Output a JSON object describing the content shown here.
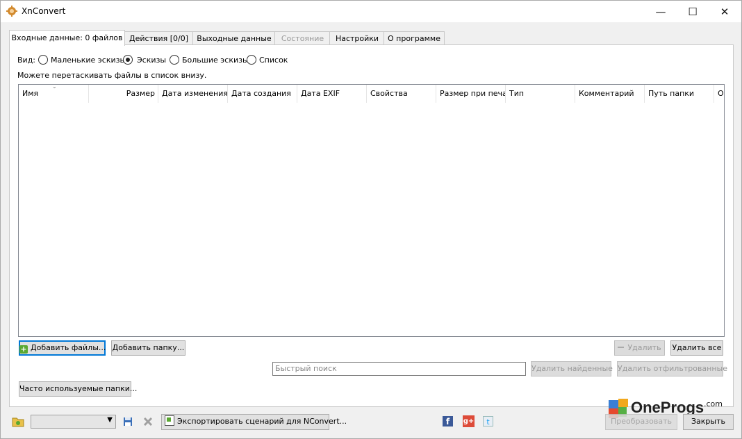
{
  "window": {
    "title": "XnConvert",
    "minimize_glyph": "—",
    "maximize_glyph": "☐",
    "close_glyph": "✕"
  },
  "tabs": [
    {
      "label": "Входные данные: 0 файлов",
      "state": "active"
    },
    {
      "label": "Действия [0/0]",
      "state": "normal"
    },
    {
      "label": "Выходные данные",
      "state": "normal"
    },
    {
      "label": "Состояние",
      "state": "disabled"
    },
    {
      "label": "Настройки",
      "state": "normal"
    },
    {
      "label": "О программе",
      "state": "normal"
    }
  ],
  "view": {
    "label": "Вид:",
    "options": [
      "Маленькие эскизы",
      "Эскизы",
      "Большие эскизы",
      "Список"
    ],
    "selected": "Эскизы"
  },
  "hint": "Можете перетаскивать файлы в список внизу.",
  "columns": [
    "Имя",
    "Размер",
    "Дата изменения",
    "Дата создания",
    "Дата EXIF",
    "Свойства",
    "Размер при печа",
    "Тип",
    "Комментарий",
    "Путь папки",
    "О"
  ],
  "buttons": {
    "add_files": "Добавить файлы...",
    "add_folder": "Добавить папку...",
    "delete": "Удалить",
    "delete_all": "Удалить все",
    "delete_found": "Удалить найденные",
    "delete_filtered": "Удалить отфильтрованные",
    "frequent_folders": "Часто используемые папки...",
    "export_script": "Экспортировать сценарий для NConvert...",
    "convert": "Преобразовать",
    "close": "Закрыть"
  },
  "search": {
    "placeholder": "Быстрый поиск"
  },
  "watermark": {
    "brand": "OneProgs",
    "suffix": ".com"
  },
  "icons": {
    "app": "xnconvert-gear-icon",
    "add": "plus-icon",
    "folder": "folder-icon",
    "save": "save-icon",
    "delete": "delete-x-icon",
    "export": "export-icon",
    "facebook": "facebook-icon",
    "google_plus": "google-plus-icon",
    "twitter": "twitter-icon"
  },
  "colors": {
    "accent": "#0078d7",
    "facebook": "#3b5998",
    "google_plus": "#dd4b39",
    "twitter": "#1da1f2"
  }
}
